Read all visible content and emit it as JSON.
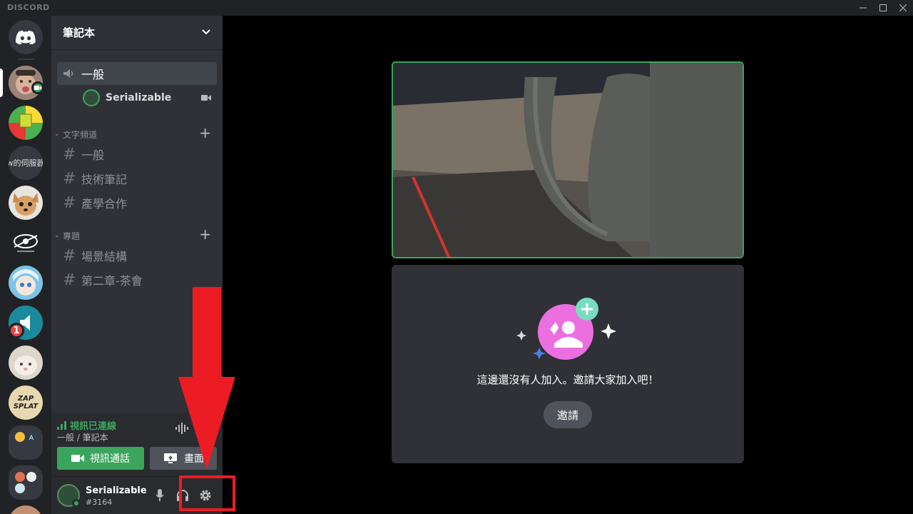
{
  "app": {
    "brand": "DISCORD"
  },
  "guild": {
    "name": "筆記本"
  },
  "voice_channel": {
    "name": "一般",
    "user": "Serializable"
  },
  "categories": [
    {
      "name": "文字頻道",
      "channels": [
        "一般",
        "技術筆記",
        "產學合作"
      ]
    },
    {
      "name": "專題",
      "channels": [
        "場景結構",
        "第二章-茶會"
      ]
    }
  ],
  "server_rail": {
    "badge_count": "1",
    "server_text": "w的伺服器",
    "zap_label_1": "ZAP",
    "zap_label_2": "SPLAT"
  },
  "rtc_panel": {
    "status": "視訊已連線",
    "location": "一般 / 筆記本",
    "video_button": "視訊通話",
    "screen_button": "畫面"
  },
  "user_panel": {
    "username": "Serializable",
    "tag": "#3164"
  },
  "stage": {
    "invite_message": "這邊還沒有人加入。邀請大家加入吧！",
    "invite_button": "邀請"
  },
  "colors": {
    "connected_green": "#3ba55d",
    "annotation_red": "#ed1c24",
    "invite_pink": "#ee82ee",
    "invite_teal": "#6fd9b8"
  }
}
